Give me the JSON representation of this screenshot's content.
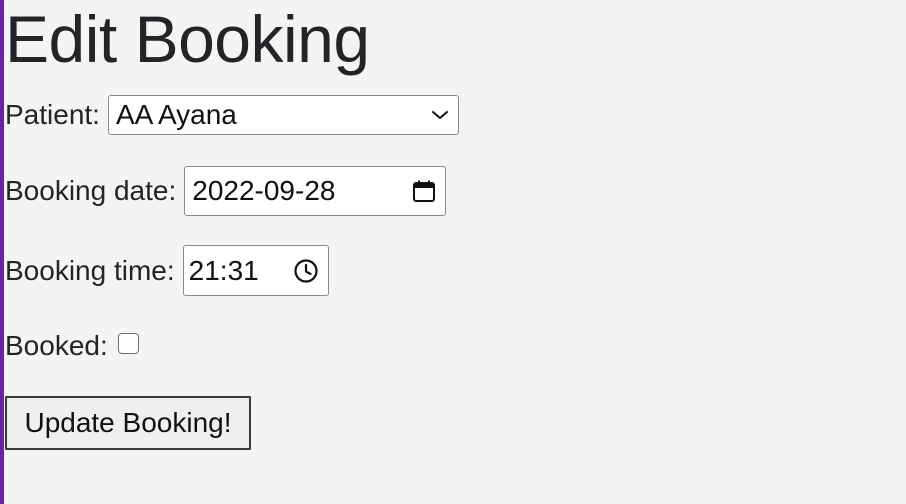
{
  "page": {
    "title": "Edit Booking"
  },
  "form": {
    "patient_label": "Patient:",
    "patient_value": "AA Ayana",
    "date_label": "Booking date:",
    "date_value": "2022-09-28",
    "time_label": "Booking time:",
    "time_value": "21:31",
    "booked_label": "Booked:",
    "booked_checked": false,
    "submit_label": "Update Booking!"
  },
  "icons": {
    "patient_dropdown": "chevron-down-icon",
    "date_picker": "calendar-icon",
    "time_picker": "clock-icon"
  },
  "colors": {
    "background": "#f4f4f4",
    "accent": "#6b21a8",
    "text": "#222428"
  }
}
